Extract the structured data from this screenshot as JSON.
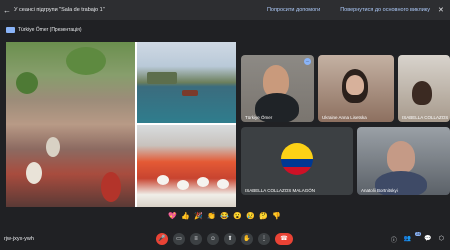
{
  "topbar": {
    "back_icon": "arrow-left-icon",
    "title": "У сеансі підгрупи \"Sala de trabajo 1\"",
    "help_label": "Попросити допомоги",
    "return_label": "Повернутися до основного виклику",
    "close_icon": "close-icon"
  },
  "presentation": {
    "label": "Türkiye Ömer (Презентація)"
  },
  "participants": [
    {
      "name": "Türkiye Ömer"
    },
    {
      "name": "Ukraine Anna Lisetska"
    },
    {
      "name": "ISABELLA COLLAZOS"
    },
    {
      "name": "ISABELLA COLLAZOS MALAGÓN"
    },
    {
      "name": "Anatolii Bortnitskyi"
    }
  ],
  "reactions": [
    "💖",
    "👍",
    "🎉",
    "👏",
    "😂",
    "😮",
    "😢",
    "🤔",
    "👎"
  ],
  "meeting": {
    "code": "rjw-jxyx-ywh"
  },
  "controls": [
    "mic-off-icon",
    "camera-icon",
    "captions-icon",
    "emoji-icon",
    "present-icon",
    "raise-hand-icon",
    "more-icon",
    "end-call-icon"
  ],
  "right_panel": {
    "badge_count": "24"
  },
  "colors": {
    "accent": "#8ab4f8",
    "danger": "#ea4335",
    "background": "#202124"
  }
}
